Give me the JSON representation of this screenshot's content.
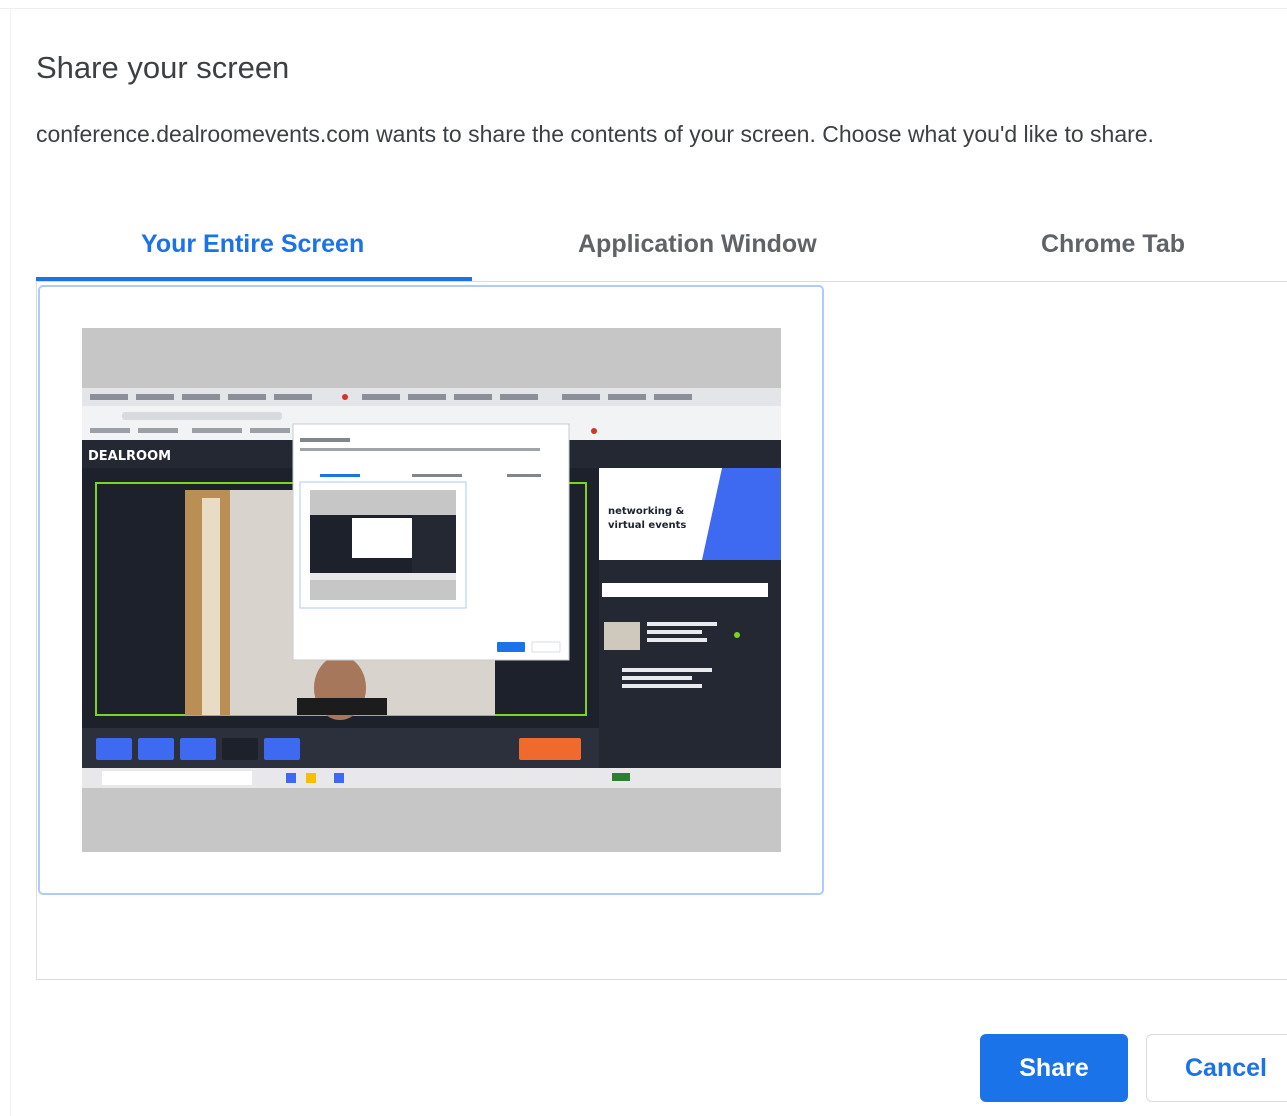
{
  "dialog": {
    "title": "Share your screen",
    "description": "conference.dealroomevents.com wants to share the contents of your screen. Choose what you'd like to share."
  },
  "tabs": [
    {
      "label": "Your Entire Screen",
      "active": true
    },
    {
      "label": "Application Window",
      "active": false
    },
    {
      "label": "Chrome Tab",
      "active": false
    }
  ],
  "thumbnail": {
    "app_logo": "DEALROOM",
    "promo_line1": "networking &",
    "promo_line2": "virtual events"
  },
  "buttons": {
    "share": "Share",
    "cancel": "Cancel"
  },
  "colors": {
    "accent": "#1a73e8",
    "selection_border": "#aecbfa"
  }
}
